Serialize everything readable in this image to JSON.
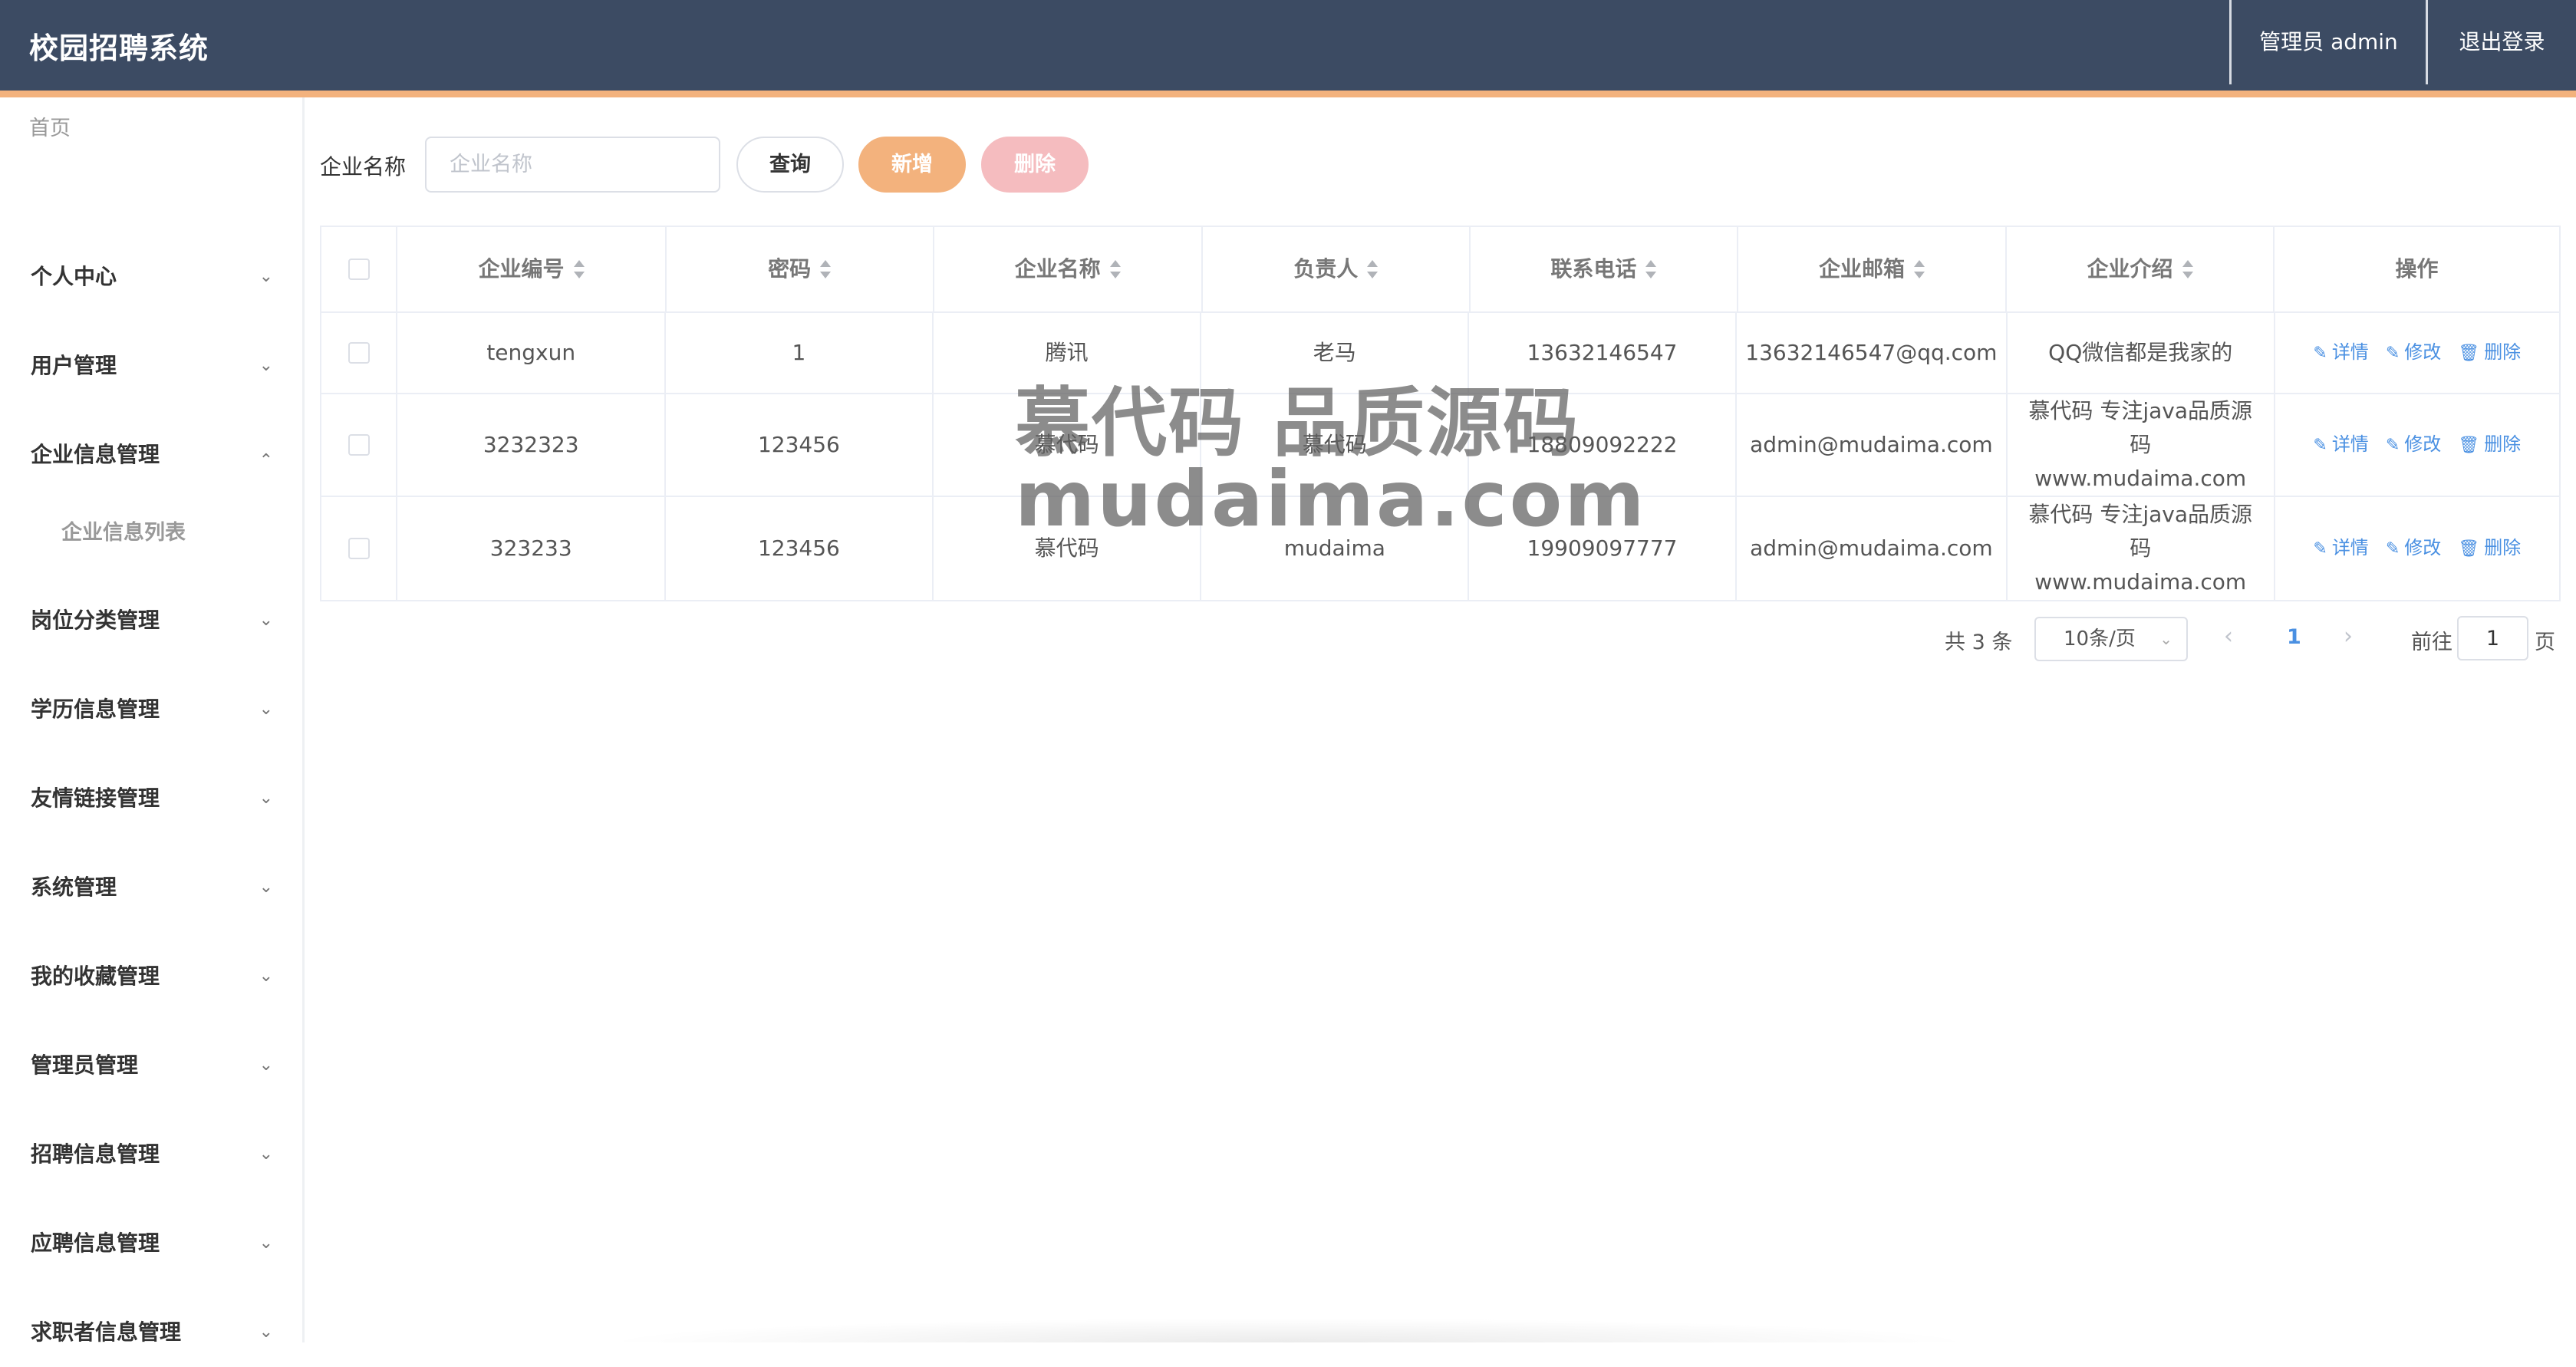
{
  "header": {
    "title": "校园招聘系统",
    "admin_label": "管理员 admin",
    "logout_label": "退出登录"
  },
  "sidebar": {
    "home": "首页",
    "items": [
      {
        "label": "个人中心",
        "expanded": false
      },
      {
        "label": "用户管理",
        "expanded": false
      },
      {
        "label": "企业信息管理",
        "expanded": true,
        "children": [
          "企业信息列表"
        ]
      },
      {
        "label": "岗位分类管理",
        "expanded": false
      },
      {
        "label": "学历信息管理",
        "expanded": false
      },
      {
        "label": "友情链接管理",
        "expanded": false
      },
      {
        "label": "系统管理",
        "expanded": false
      },
      {
        "label": "我的收藏管理",
        "expanded": false
      },
      {
        "label": "管理员管理",
        "expanded": false
      },
      {
        "label": "招聘信息管理",
        "expanded": false
      },
      {
        "label": "应聘信息管理",
        "expanded": false
      },
      {
        "label": "求职者信息管理",
        "expanded": false
      }
    ]
  },
  "search": {
    "label": "企业名称",
    "placeholder": "企业名称",
    "value": "",
    "query_label": "查询",
    "add_label": "新增",
    "delete_label": "删除"
  },
  "table": {
    "columns": [
      "企业编号",
      "密码",
      "企业名称",
      "负责人",
      "联系电话",
      "企业邮箱",
      "企业介绍",
      "操作"
    ],
    "rows": [
      [
        "tengxun",
        "1",
        "腾讯",
        "老马",
        "13632146547",
        "13632146547@qq.com",
        "QQ微信都是我家的"
      ],
      [
        "3232323",
        "123456",
        "慕代码",
        "慕代码",
        "18809092222",
        "admin@mudaima.com",
        "慕代码 专注java品质源码 www.mudaima.com"
      ],
      [
        "323233",
        "123456",
        "慕代码",
        "mudaima",
        "19909097777",
        "admin@mudaima.com",
        "慕代码 专注java品质源码 www.mudaima.com"
      ]
    ],
    "actions": {
      "detail": "详情",
      "edit": "修改",
      "delete": "删除"
    }
  },
  "pagination": {
    "total_text": "共 3 条",
    "page_size": "10条/页",
    "current_page": "1",
    "goto_label": "前往",
    "goto_value": "1",
    "page_suffix": "页"
  },
  "watermark": {
    "line1": "慕代码 品质源码",
    "line2": "mudaima.com"
  },
  "icons": {
    "chevron_down": "chevron-down-icon",
    "chevron_up": "chevron-up-icon",
    "sort": "sort-icon",
    "edit": "edit-icon",
    "trash": "trash-icon"
  }
}
